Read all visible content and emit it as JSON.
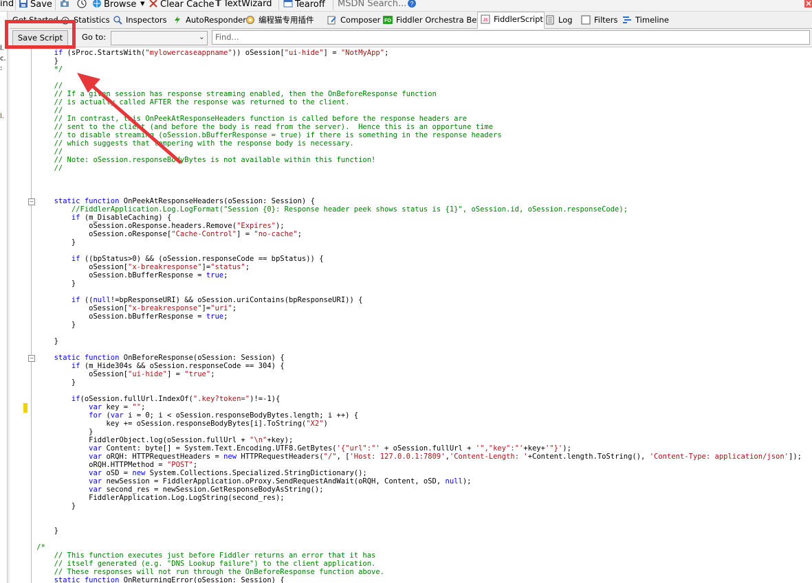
{
  "toolbar": {
    "left_cut": "ind",
    "save": "Save",
    "browse": "Browse",
    "clear_cache": "Clear Cache",
    "textwizard": "TextWizard",
    "tearoff": "Tearoff",
    "msdn_search": "MSDN Search..."
  },
  "tabs": {
    "get_started": "Get Started",
    "statistics": "Statistics",
    "inspectors": "Inspectors",
    "autoresponder": "AutoResponder",
    "plugin_cn": "编程猫专用插件",
    "composer": "Composer",
    "orchestra": "Fiddler Orchestra Beta",
    "fiddlerscript": "FiddlerScript",
    "log": "Log",
    "filters": "Filters",
    "timeline": "Timeline"
  },
  "scriptbar": {
    "save_script": "Save Script",
    "goto_label": "Go to:",
    "goto_value": "",
    "find_placeholder": "Find..."
  },
  "left_strip_marks": [
    "l.",
    "c.",
    ":",
    "l."
  ],
  "code_lines": [
    "        if (sProc.StartsWith(\"mylowercaseappname\")) oSession[\"ui-hide\"] = \"NotMyApp\";",
    "        }",
    "        */",
    "",
    "        //",
    "        // If a given session has response streaming enabled, then the OnBeforeResponse function",
    "        // is actually called AFTER the response was returned to the client.",
    "        //",
    "        // In contrast, this OnPeekAtResponseHeaders function is called before the response headers are",
    "        // sent to the client (and before the body is read from the server).  Hence this is an opportune time",
    "        // to disable streaming (oSession.bBufferResponse = true) if there is something in the response headers",
    "        // which suggests that tampering with the response body is necessary.",
    "        //",
    "        // Note: oSession.responseBodyBytes is not available within this function!",
    "        //",
    "",
    "",
    "",
    "        static function OnPeekAtResponseHeaders(oSession: Session) {",
    "            //FiddlerApplication.Log.LogFormat(\"Session {0}: Response header peek shows status is {1}\", oSession.id, oSession.responseCode);",
    "            if (m_DisableCaching) {",
    "                oSession.oResponse.headers.Remove(\"Expires\");",
    "                oSession.oResponse[\"Cache-Control\"] = \"no-cache\";",
    "            }",
    "",
    "            if ((bpStatus>0) && (oSession.responseCode == bpStatus)) {",
    "                oSession[\"x-breakresponse\"]=\"status\";",
    "                oSession.bBufferResponse = true;",
    "            }",
    "",
    "            if ((null!=bpResponseURI) && oSession.uriContains(bpResponseURI)) {",
    "                oSession[\"x-breakresponse\"]=\"uri\";",
    "                oSession.bBufferResponse = true;",
    "            }",
    "",
    "        }",
    "",
    "        static function OnBeforeResponse(oSession: Session) {",
    "            if (m_Hide304s && oSession.responseCode == 304) {",
    "                oSession[\"ui-hide\"] = \"true\";",
    "            }",
    "",
    "            if(oSession.fullUrl.IndexOf(\".key?token=\")!=-1){",
    "                var key = \"\";",
    "                for (var i = 0; i < oSession.responseBodyBytes.length; i ++) {",
    "                    key += oSession.responseBodyBytes[i].ToString(\"X2\")",
    "                }",
    "                FiddlerObject.log(oSession.fullUrl + \"\\n\"+key);",
    "                var Content: byte[] = System.Text.Encoding.UTF8.GetBytes('{\"url\":\"' + oSession.fullUrl + '\",\"key\":\"'+key+'\"}');",
    "                var oRQH: HTTPRequestHeaders = new HTTPRequestHeaders(\"/\", ['Host: 127.0.0.1:7809','Content-Length: '+Content.length.ToString(), 'Content-Type: application/json']);",
    "                oRQH.HTTPMethod = \"POST\";",
    "                var oSD = new System.Collections.Specialized.StringDictionary();",
    "                var newSession = FiddlerApplication.oProxy.SendRequestAndWait(oRQH, Content, oSD, null);",
    "                var second_res = newSession.GetResponseBodyAsString();",
    "                FiddlerApplication.Log.LogString(second_res);",
    "            }",
    "",
    "",
    "        }",
    "",
    "    /*",
    "        // This function executes just before Fiddler returns an error that it has",
    "        // itself generated (e.g. \"DNS Lookup failure\") to the client application.",
    "        // These responses will not run through the OnBeforeResponse function above.",
    "        static function OnReturningError(oSession: Session) {"
  ],
  "colors": {
    "comment": "#008000",
    "keyword": "#0000ff",
    "string": "#a31515",
    "annotation_red": "#e5363a"
  }
}
